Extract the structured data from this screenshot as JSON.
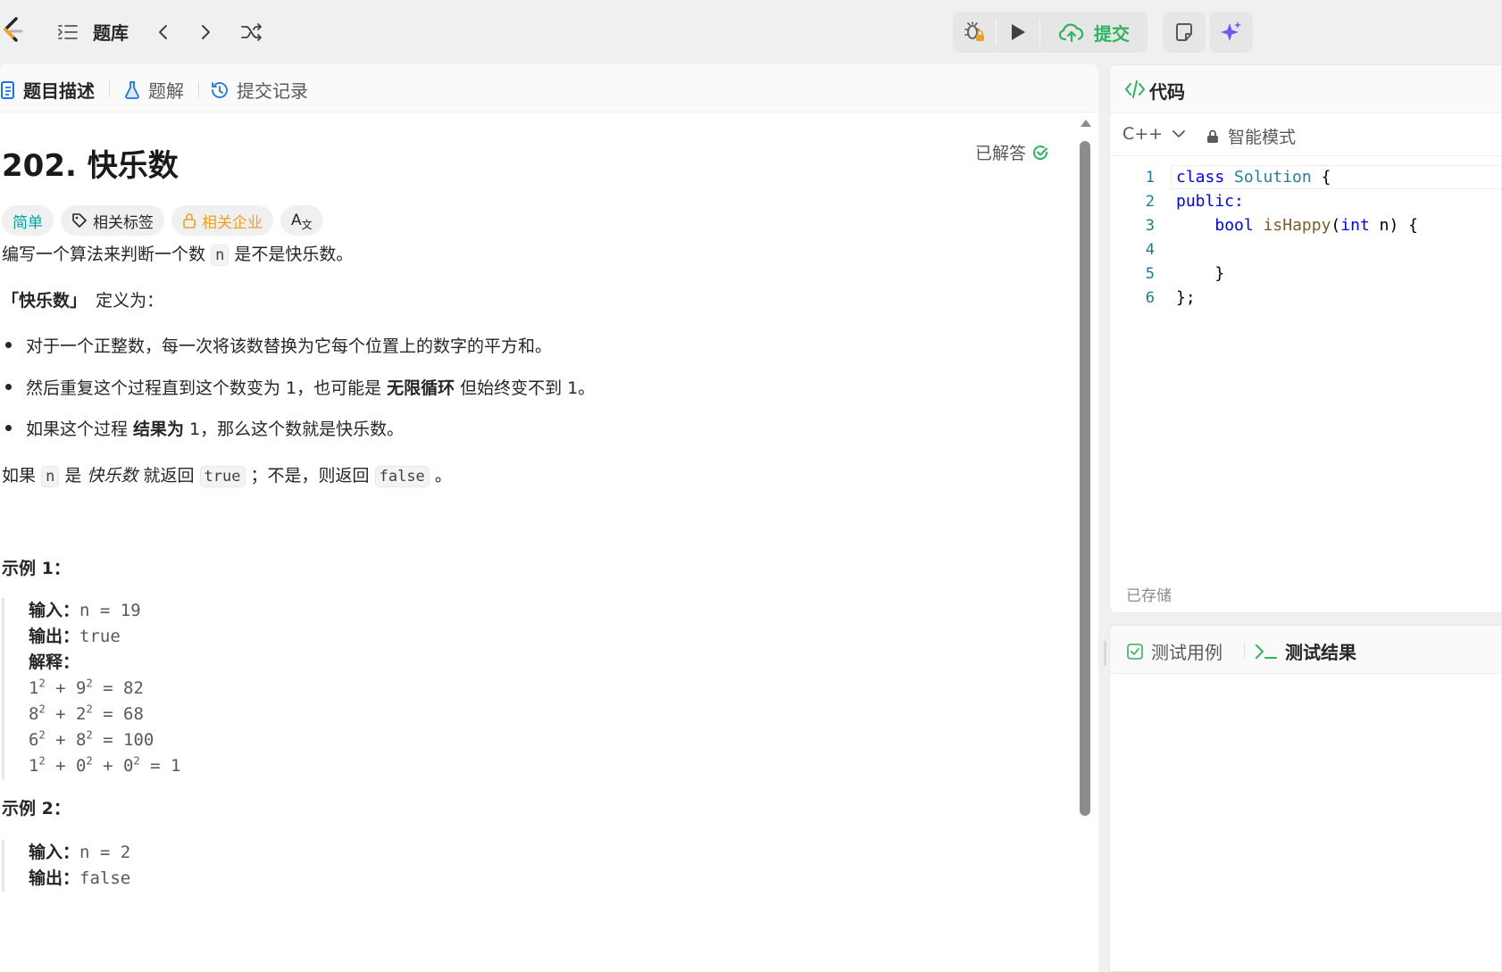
{
  "topbar": {
    "title": "题库",
    "submit_label": "提交",
    "icons": [
      "logo-icon",
      "list-icon",
      "chevron-left-icon",
      "chevron-right-icon",
      "shuffle-icon",
      "debug-lock-icon",
      "play-icon",
      "cloud-upload-icon",
      "note-icon",
      "sparkle-icon"
    ]
  },
  "left_tabs": {
    "description": "题目描述",
    "solutions": "题解",
    "submissions": "提交记录"
  },
  "problem": {
    "title": "202. 快乐数",
    "solved_label": "已解答",
    "chips": {
      "difficulty": "简单",
      "tags": "相关标签",
      "companies": "相关企业",
      "translate": "A"
    },
    "intro_before": "编写一个算法来判断一个数",
    "intro_var": "n",
    "intro_after": "是不是快乐数。",
    "def_bold": "「快乐数」",
    "def_rest": "定义为：",
    "bullets": {
      "b1": "对于一个正整数，每一次将该数替换为它每个位置上的数字的平方和。",
      "b2_before": "然后重复这个过程直到这个数变为 1，也可能是",
      "b2_bold": "无限循环",
      "b2_after": "但始终变不到 1。",
      "b3_before": "如果这个过程",
      "b3_bold": "结果为",
      "b3_after": "1，那么这个数就是快乐数。"
    },
    "ret_1": "如果",
    "ret_var": "n",
    "ret_2": "是",
    "ret_italic": "快乐数",
    "ret_3": "就返回",
    "ret_true": "true",
    "ret_4": "；不是，则返回",
    "ret_false": "false",
    "ret_5": "。",
    "example1": {
      "title": "示例 1：",
      "input_label": "输入：",
      "input_value": "n = 19",
      "output_label": "输出：",
      "output_value": "true",
      "explain_label": "解释：",
      "lines": [
        {
          "a": "1",
          "b": "9",
          "rest": " = 82"
        },
        {
          "a": "8",
          "b": "2",
          "rest": " = 68"
        },
        {
          "a": "6",
          "b": "8",
          "rest": " = 100"
        }
      ],
      "last_line": {
        "a": "1",
        "b": "0",
        "c": "0",
        "rest": " = 1"
      },
      "sup": "2",
      "plus": " + "
    },
    "example2": {
      "title": "示例 2：",
      "input_label": "输入：",
      "input_value": "n = 2",
      "output_label": "输出：",
      "output_value": "false"
    }
  },
  "code_panel": {
    "title": "代码",
    "language": "C++",
    "mode": "智能模式",
    "saved": "已存储",
    "line_numbers": [
      "1",
      "2",
      "3",
      "4",
      "5",
      "6"
    ],
    "code": {
      "l1_kw": "class",
      "l1_type": "Solution",
      "l1_rest": " {",
      "l2_kw": "public:",
      "l3_kw": "bool",
      "l3_fn": "isHappy",
      "l3_open": "(",
      "l3_int": "int",
      "l3_rest": " n) {",
      "l5": "}",
      "l6": "};"
    }
  },
  "test_panel": {
    "cases": "测试用例",
    "results": "测试结果"
  }
}
